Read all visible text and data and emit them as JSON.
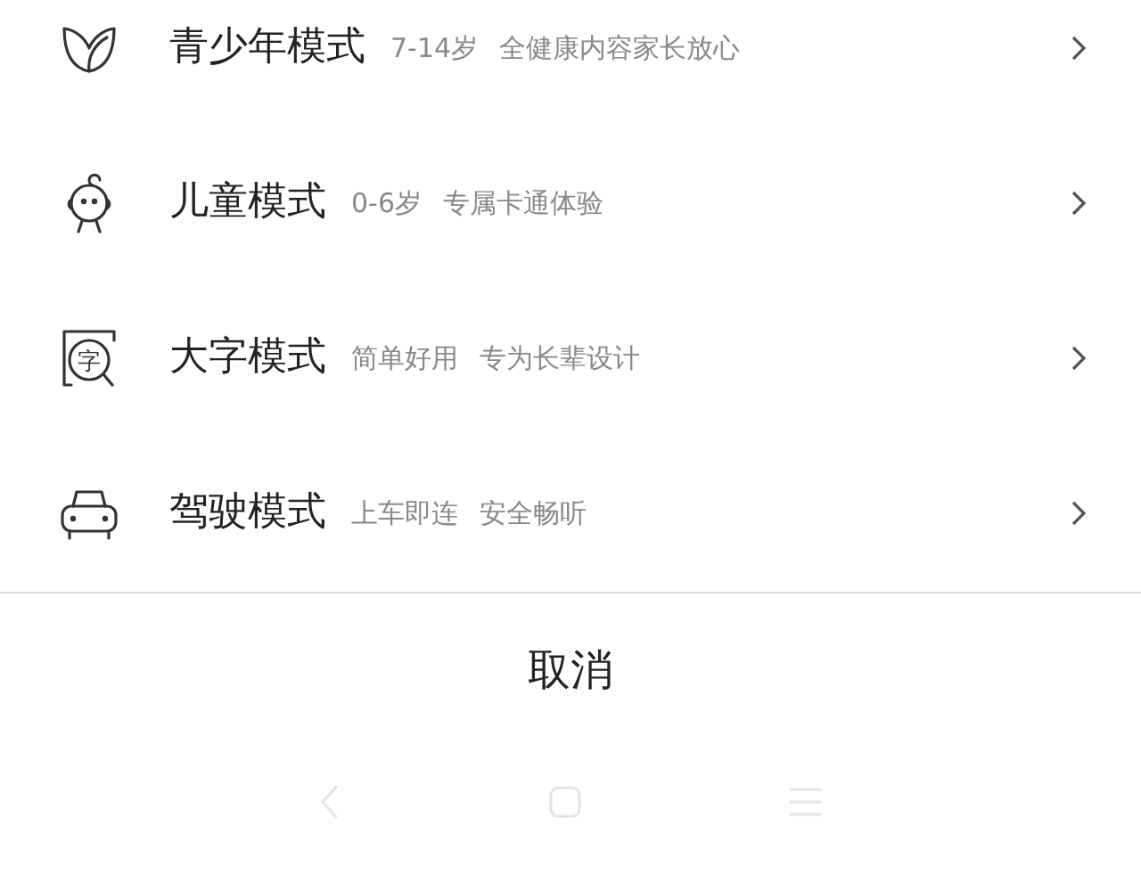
{
  "modes": [
    {
      "kind": "youth",
      "title": "青少年模式",
      "tags": [
        "7-14岁",
        "全健康内容家长放心"
      ]
    },
    {
      "kind": "child",
      "title": "儿童模式",
      "tags": [
        "0-6岁",
        "专属卡通体验"
      ]
    },
    {
      "kind": "elder",
      "icon_label": "字",
      "title": "大字模式",
      "tags": [
        "简单好用",
        "专为长辈设计"
      ]
    },
    {
      "kind": "driving",
      "title": "驾驶模式",
      "tags": [
        "上车即连",
        "安全畅听"
      ]
    }
  ],
  "cancel": "取消"
}
